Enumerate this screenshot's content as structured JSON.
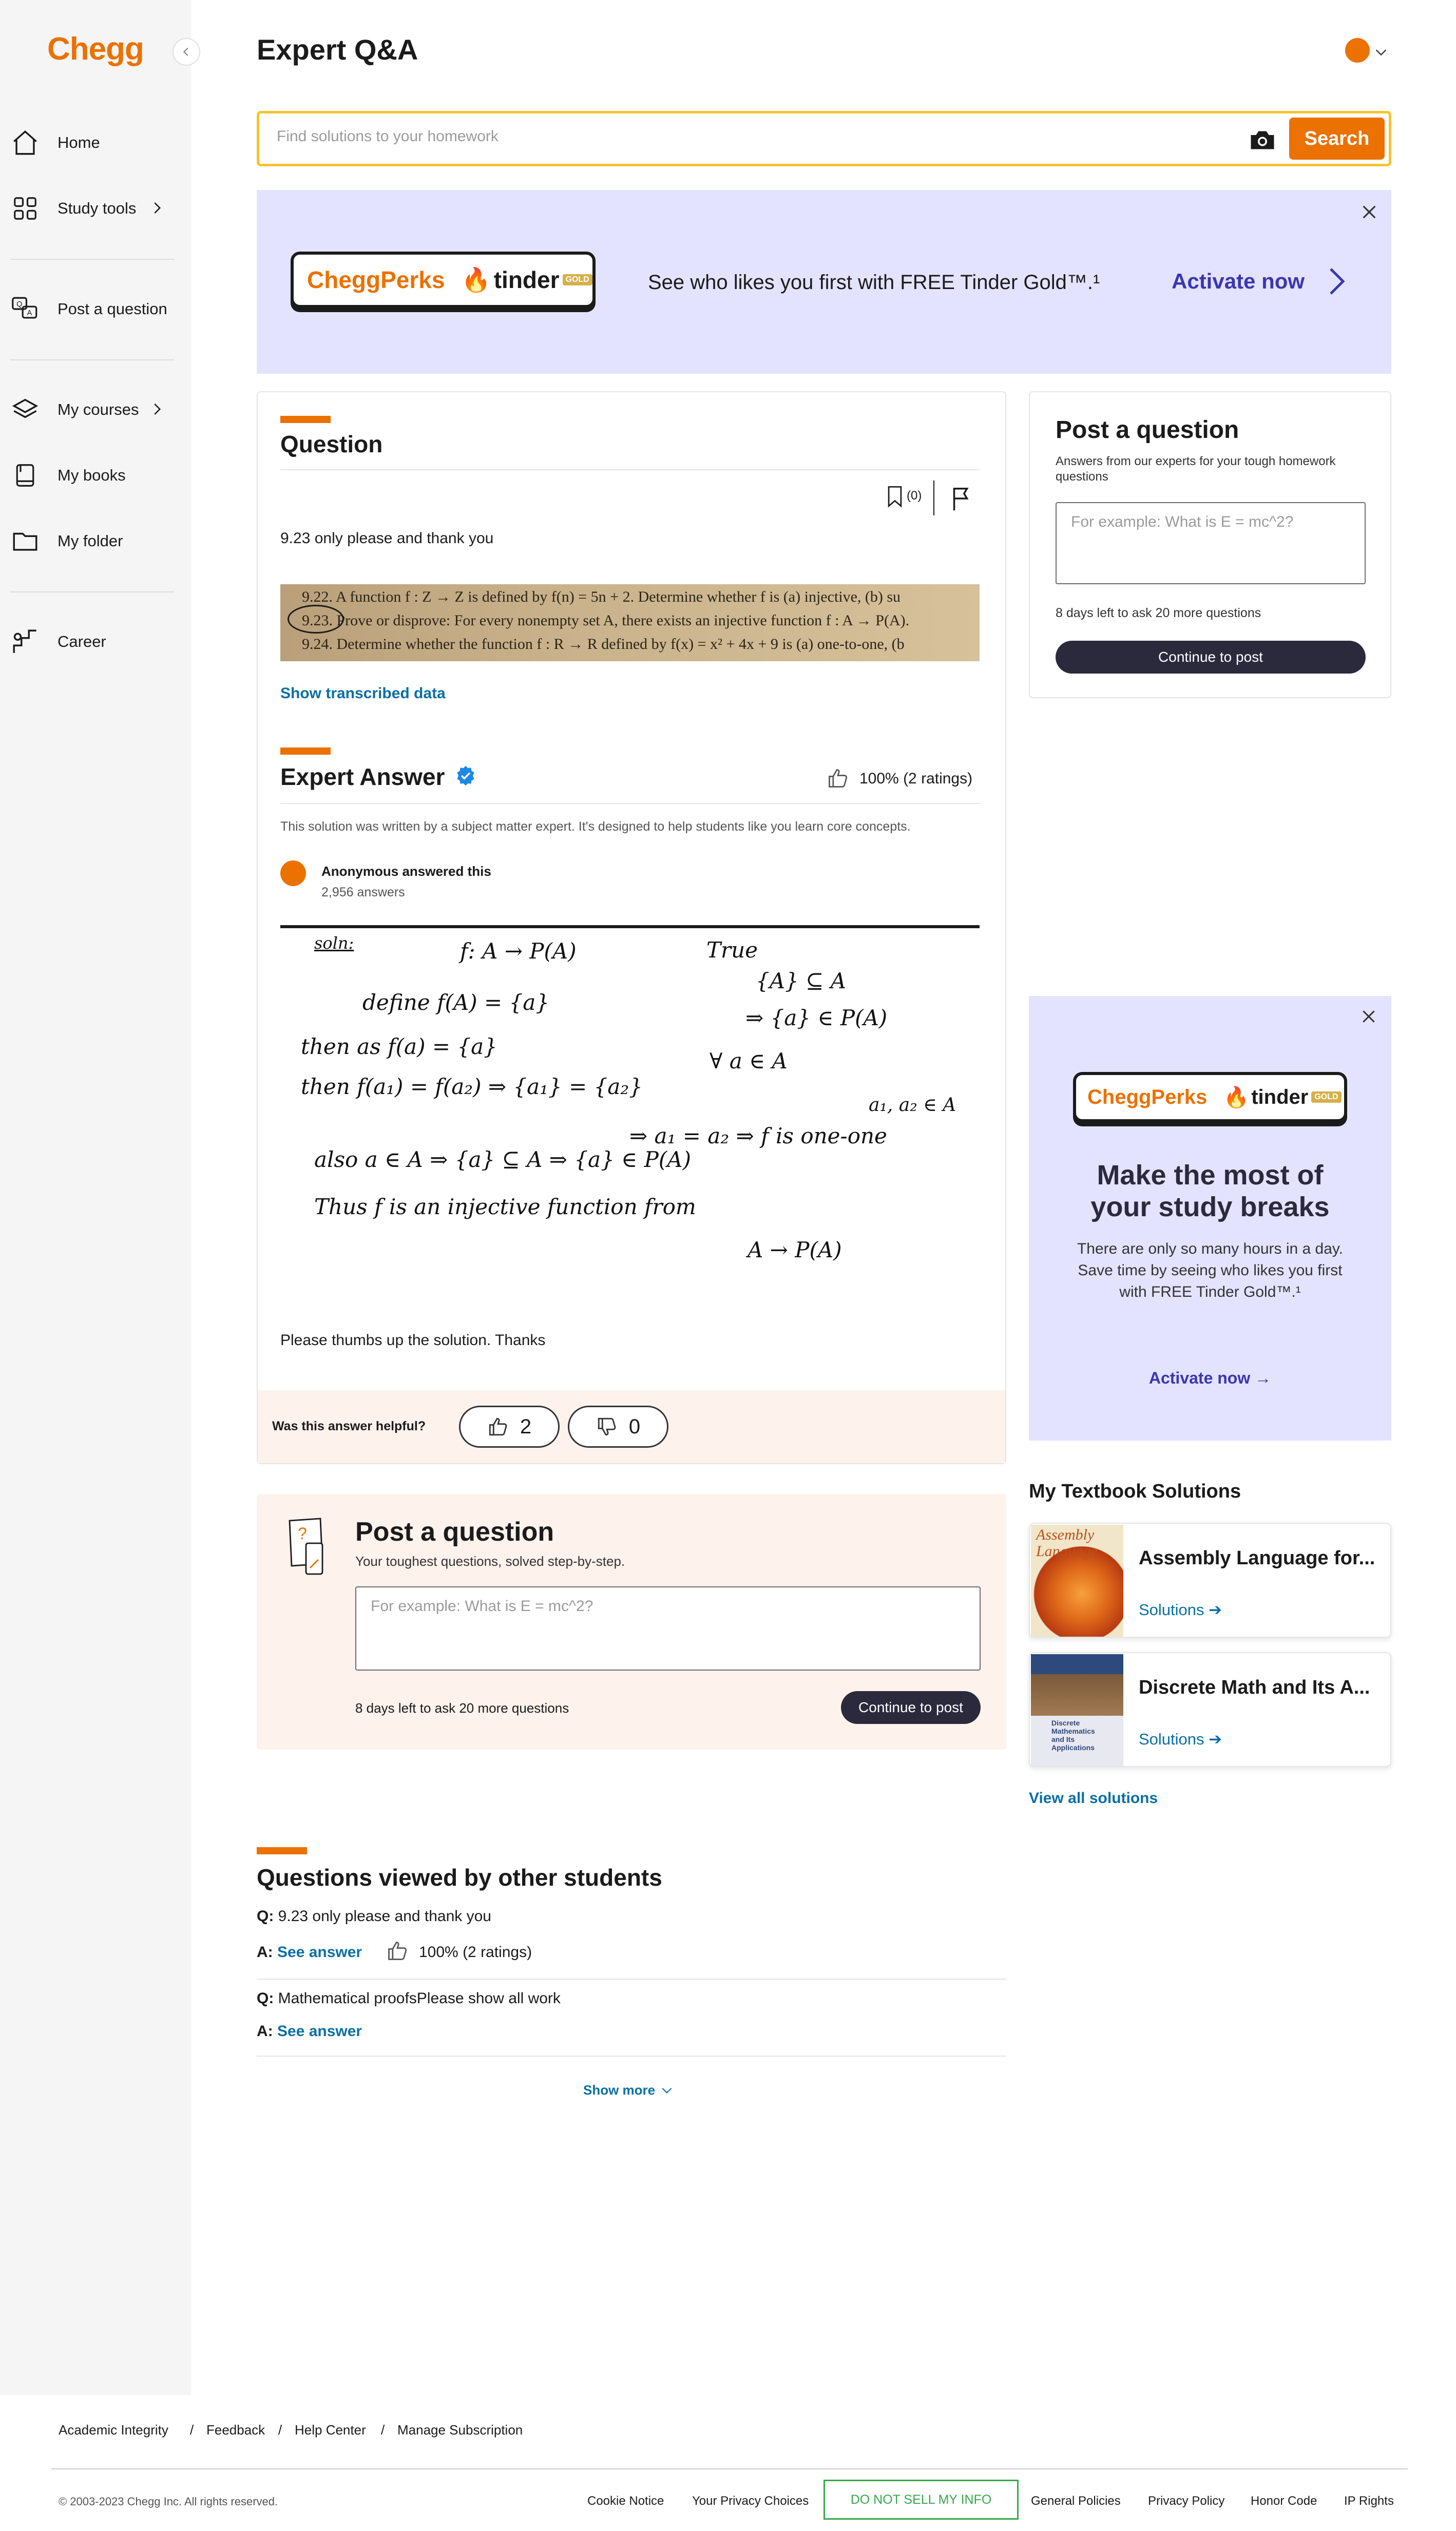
{
  "brand": {
    "logo": "Chegg",
    "accent": "#eb7100"
  },
  "sidebar": {
    "items": [
      {
        "label": "Home",
        "icon": "home-icon"
      },
      {
        "label": "Study tools",
        "icon": "grid-icon"
      },
      {
        "label": "Post a question",
        "icon": "chat-icon"
      },
      {
        "label": "My courses",
        "icon": "layers-icon"
      },
      {
        "label": "My books",
        "icon": "book-icon"
      },
      {
        "label": "My folder",
        "icon": "folder-icon"
      },
      {
        "label": "Career",
        "icon": "career-icon"
      }
    ]
  },
  "header": {
    "title": "Expert Q&A"
  },
  "search": {
    "placeholder": "Find solutions to your homework",
    "button": "Search"
  },
  "promo": {
    "perks_label": "CheggPerks",
    "tinder_label": "tinder",
    "gold_tag": "GOLD",
    "text": "See who likes you first with FREE Tinder Gold™.¹",
    "cta": "Activate now"
  },
  "question": {
    "heading": "Question",
    "bookmark_count": "(0)",
    "text": "9.23 only please and thank you",
    "image_lines": [
      "9.22.  A function f : Z → Z is defined by f(n) = 5n + 2. Determine whether f is (a) injective, (b) su",
      "9.23.  Prove or disprove: For every nonempty set A, there exists an injective function f : A → P(A).",
      "9.24.  Determine whether the function f : R → R defined by f(x) = x² + 4x + 9 is (a) one-to-one, (b"
    ],
    "show_transcribed": "Show transcribed data"
  },
  "answer": {
    "heading": "Expert Answer",
    "rating": "100% (2 ratings)",
    "disclaimer": "This solution was written by a subject matter expert. It's designed to help students like you learn core concepts.",
    "author": "Anonymous answered this",
    "author_count": "2,956 answers",
    "handwriting": [
      "soln:",
      "f: A → P(A)",
      "True",
      "{A} ⊆ A",
      "define f(A) = {a}",
      "⇒ {a} ∈ P(A)",
      "then  as  f(a) = {a}",
      "∀ a ∈ A",
      "then  f(a₁) = f(a₂)  ⇒  {a₁} = {a₂}",
      "a₁, a₂ ∈ A",
      "⇒  a₁ = a₂  ⇒  f is one-one",
      "also  a ∈ A  ⇒  {a} ⊆ A  ⇒  {a} ∈ P(A)",
      "Thus  f is an injective function from",
      "A → P(A)"
    ],
    "closing": "Please thumbs up the solution. Thanks",
    "helpful_label": "Was this answer helpful?",
    "up_count": "2",
    "down_count": "0"
  },
  "post_side": {
    "title": "Post a question",
    "subtitle": "Answers from our experts for your tough homework questions",
    "placeholder": "For example: What is E = mc^2?",
    "days_left": "8 days left to ask 20 more questions",
    "button": "Continue to post"
  },
  "perks_side": {
    "title": "Make the most of your study breaks",
    "text": "There are only so many hours in a day. Save time by seeing who likes you first with FREE Tinder Gold™.¹",
    "cta": "Activate now →"
  },
  "textbooks": {
    "heading": "My Textbook Solutions",
    "items": [
      {
        "title": "Assembly Language for...",
        "cover_text": "Assembly Language",
        "link": "Solutions ➔"
      },
      {
        "title": "Discrete Math and Its A...",
        "cover_text": "Discrete Mathematics and Its Applications",
        "link": "Solutions ➔"
      }
    ],
    "view_all": "View all solutions"
  },
  "post_main": {
    "title": "Post a question",
    "subtitle": "Your toughest questions, solved step-by-step.",
    "placeholder": "For example: What is E = mc^2?",
    "days_left": "8 days left to ask 20 more questions",
    "button": "Continue to post"
  },
  "related": {
    "heading": "Questions viewed by other students",
    "items": [
      {
        "q_prefix": "Q:",
        "q": "9.23 only please and thank you",
        "a_prefix": "A:",
        "a": "See answer",
        "rating": "100% (2 ratings)"
      },
      {
        "q_prefix": "Q:",
        "q": "Mathematical proofsPlease show all work",
        "a_prefix": "A:",
        "a": "See answer"
      }
    ],
    "show_more": "Show more"
  },
  "footer": {
    "links": [
      "Academic Integrity",
      "Feedback",
      "Help Center",
      "Manage Subscription"
    ],
    "separator": "/",
    "copyright": "© 2003-2023 Chegg Inc. All rights reserved.",
    "legal": [
      "Cookie Notice",
      "Your Privacy Choices",
      "DO NOT SELL MY INFO",
      "General Policies",
      "Privacy Policy",
      "Honor Code",
      "IP Rights"
    ]
  }
}
